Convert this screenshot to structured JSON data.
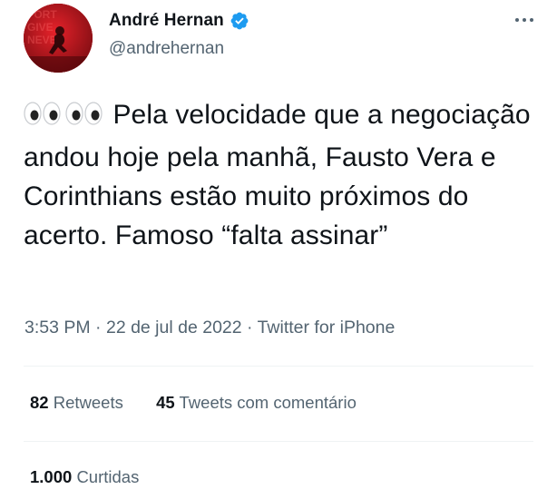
{
  "tweet": {
    "author": {
      "display_name": "André Hernan",
      "handle": "@andrehernan",
      "verified": true
    },
    "more_icon": "more-horizontal-icon",
    "text_emoji": "eyes-icon",
    "text": "Pela velocidade que a negociação andou hoje pela manhã, Fausto Vera e Corinthians estão muito próximos do acerto. Famoso “falta assinar”",
    "meta": {
      "time": "3:53 PM",
      "sep1": " · ",
      "date": "22 de jul de 2022",
      "sep2": " · ",
      "source": "Twitter for iPhone"
    },
    "stats": {
      "retweets_count": "82",
      "retweets_label": "Retweets",
      "quotes_count": "45",
      "quotes_label": "Tweets com comentário",
      "likes_count": "1.000",
      "likes_label": "Curtidas"
    }
  },
  "colors": {
    "text_primary": "#0f1419",
    "text_secondary": "#536471",
    "verified_blue": "#1d9bf0",
    "divider": "#eff3f4",
    "avatar_red": "#d4141c"
  }
}
